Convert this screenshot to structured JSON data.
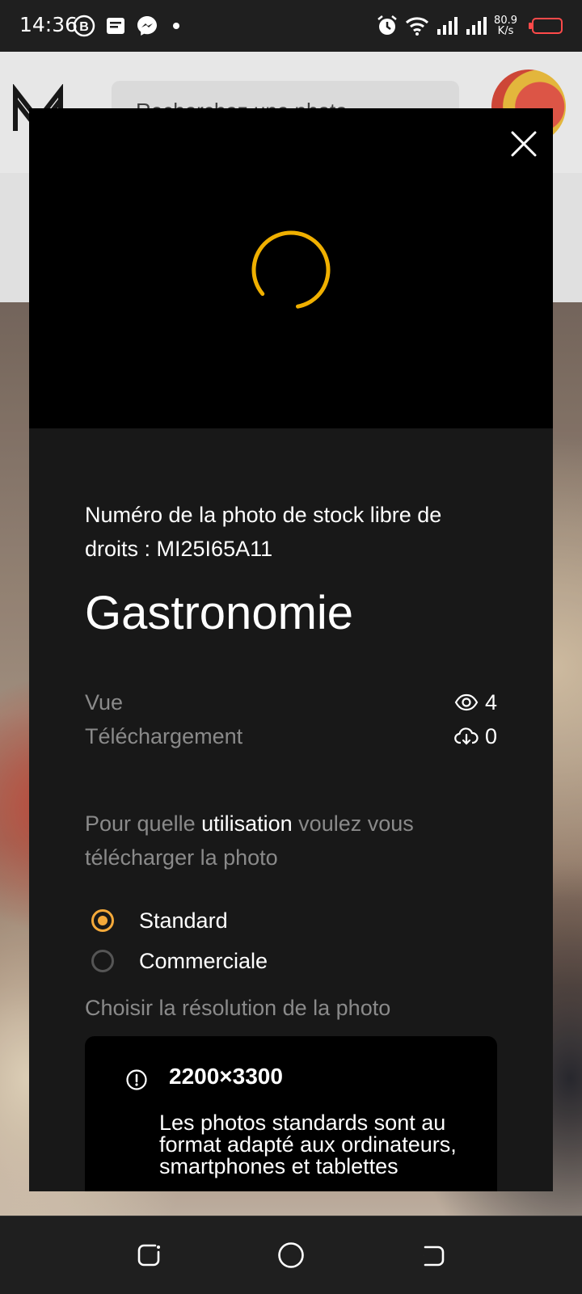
{
  "status_bar": {
    "time": "14:36",
    "net_speed_value": "80.9",
    "net_speed_unit": "K/s",
    "left_icons": [
      "b-badge-icon",
      "message-icon",
      "messenger-icon",
      "dot-icon"
    ],
    "right_icons": [
      "alarm-icon",
      "wifi-icon",
      "signal-icon",
      "signal-icon",
      "battery-icon"
    ],
    "battery_color": "#ff4a4a"
  },
  "background_page": {
    "search_placeholder": "Recherchez une photo"
  },
  "modal": {
    "loading": true,
    "accent_color": "#f4a93a",
    "reference_text": "Numéro de la photo de stock libre de droits : MI25I65A11",
    "title": "Gastronomie",
    "stats": [
      {
        "label": "Vue",
        "value": "4",
        "icon": "eye-icon"
      },
      {
        "label": "Téléchargement",
        "value": "0",
        "icon": "download-cloud-icon"
      }
    ],
    "usage_question": {
      "before": "Pour quelle ",
      "highlight": "utilisation",
      "after": " voulez vous télécharger la photo"
    },
    "usage_options": [
      {
        "label": "Standard",
        "selected": true
      },
      {
        "label": "Commerciale",
        "selected": false
      }
    ],
    "resolution_label": "Choisir la résolution de la photo",
    "resolution": {
      "value": "2200×3300",
      "description": "Les photos standards sont au format adapté aux ordinateurs, smartphones et tablettes"
    }
  },
  "nav_bar": {
    "buttons": [
      "recents-icon",
      "home-icon",
      "back-icon"
    ]
  }
}
